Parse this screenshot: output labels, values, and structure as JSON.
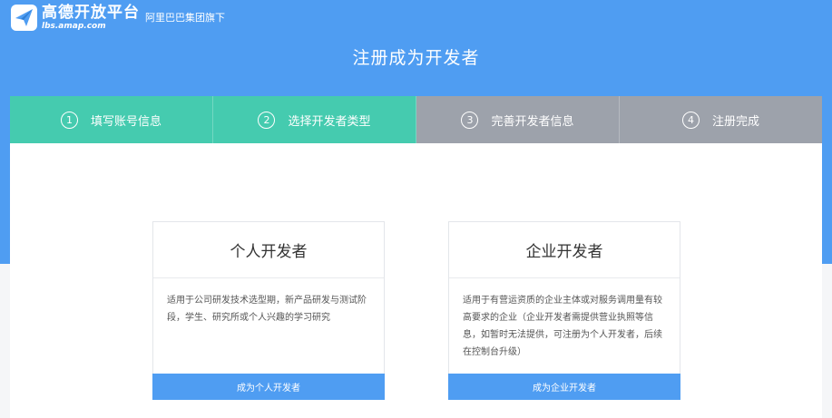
{
  "header": {
    "logo_name": "高德开放平台",
    "logo_url": "lbs.amap.com",
    "sub_brand": "阿里巴巴集团旗下",
    "brand_color": "#4f9df2",
    "logo_icon": "paper-plane-icon"
  },
  "page_title": "注册成为开发者",
  "steps": [
    {
      "number": "1",
      "label": "填写账号信息",
      "status": "done"
    },
    {
      "number": "2",
      "label": "选择开发者类型",
      "status": "active"
    },
    {
      "number": "3",
      "label": "完善开发者信息",
      "status": "pending"
    },
    {
      "number": "4",
      "label": "注册完成",
      "status": "pending"
    }
  ],
  "colors": {
    "step_done": "#45cbaf",
    "step_pending": "#9da2ab",
    "button": "#4f9df2"
  },
  "cards": [
    {
      "title": "个人开发者",
      "description": "适用于公司研发技术选型期，新产品研发与测试阶段，学生、研究所或个人兴趣的学习研究",
      "button_label": "成为个人开发者"
    },
    {
      "title": "企业开发者",
      "description": "适用于有营运资质的企业主体或对服务调用量有较高要求的企业（企业开发者需提供营业执照等信息，如暂时无法提供，可注册为个人开发者，后续在控制台升级）",
      "button_label": "成为企业开发者"
    }
  ]
}
